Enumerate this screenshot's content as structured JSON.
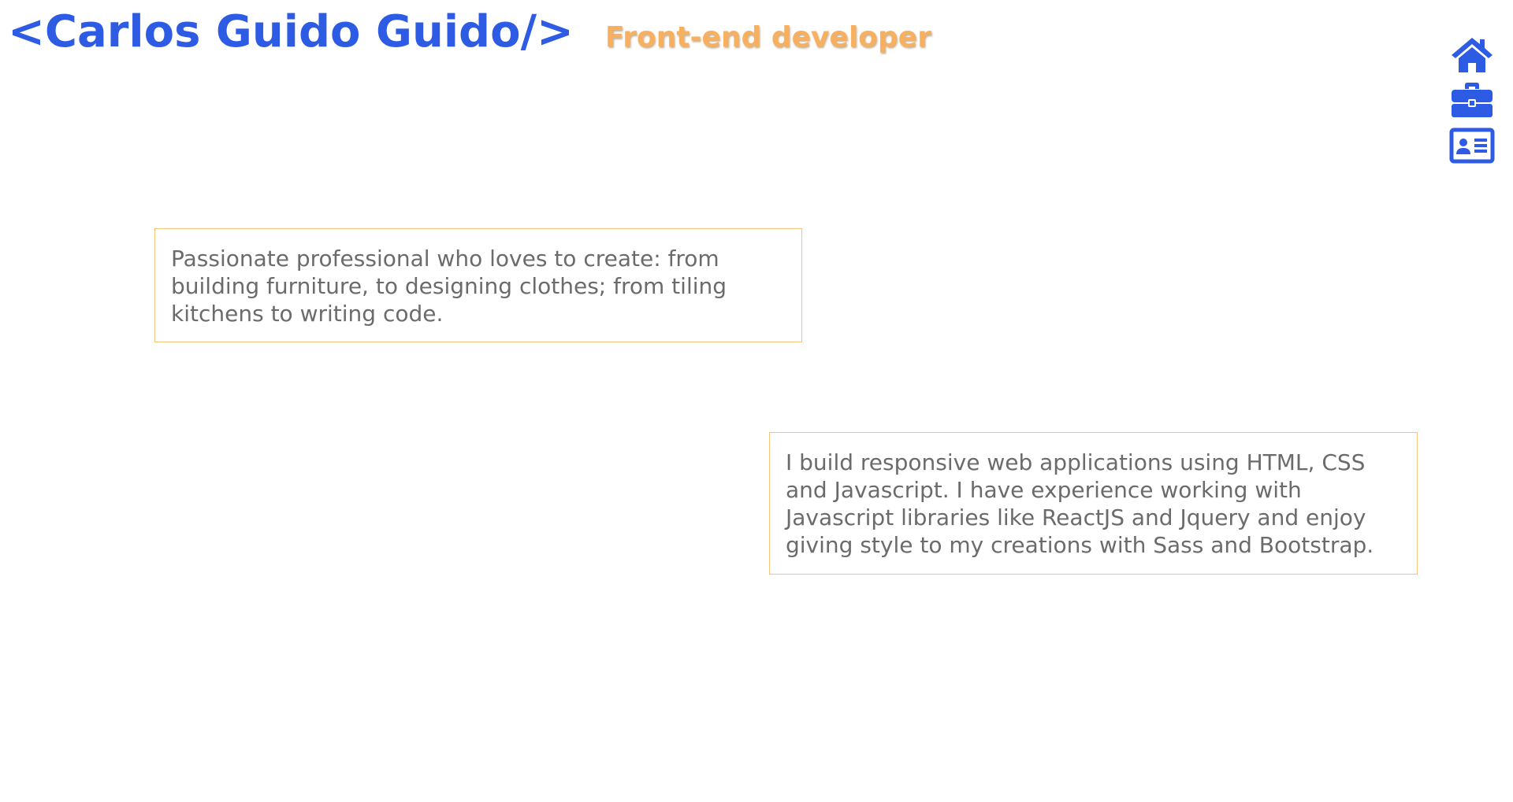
{
  "header": {
    "logo": "<Carlos Guido Guido/>",
    "role": "Front-end developer"
  },
  "nav": {
    "items": [
      {
        "icon": "home-icon"
      },
      {
        "icon": "briefcase-icon"
      },
      {
        "icon": "contact-card-icon"
      }
    ]
  },
  "cards": [
    {
      "text": "Passionate professional who loves to create: from building furniture, to designing clothes; from tiling kitchens to writing code."
    },
    {
      "text": "I build responsive web applications using HTML, CSS and Javascript. I have experience working with Javascript libraries like ReactJS and Jquery and enjoy giving style to my creations with Sass and Bootstrap."
    }
  ],
  "colors": {
    "accent": "#2d5be3",
    "secondary": "#f7b060",
    "border": "#f7c27a",
    "text": "#6b6b6b"
  }
}
